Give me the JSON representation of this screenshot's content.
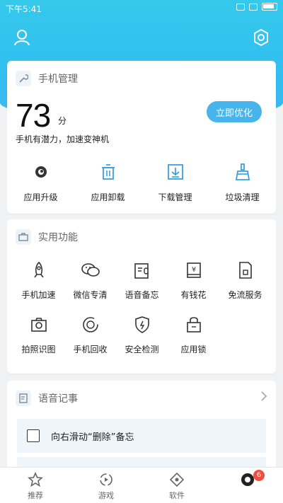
{
  "status_bar": {
    "time": "下午5:41"
  },
  "header": {
    "user_icon": "user-icon",
    "settings_icon": "settings-icon"
  },
  "phone_manager": {
    "title": "手机管理",
    "score": "73",
    "score_unit": "分",
    "description": "手机有潜力，加速变神机",
    "optimize_button": "立即优化",
    "tools": [
      {
        "label": "应用升级",
        "icon": "eye-icon"
      },
      {
        "label": "应用卸载",
        "icon": "trash-icon"
      },
      {
        "label": "下载管理",
        "icon": "download-icon"
      },
      {
        "label": "垃圾清理",
        "icon": "broom-icon"
      }
    ]
  },
  "utilities": {
    "title": "实用功能",
    "items": [
      {
        "label": "手机加速",
        "icon": "rocket-icon"
      },
      {
        "label": "微信专清",
        "icon": "wechat-icon"
      },
      {
        "label": "语音备忘",
        "icon": "voice-memo-icon"
      },
      {
        "label": "有钱花",
        "icon": "money-icon"
      },
      {
        "label": "免流服务",
        "icon": "sim-icon"
      },
      {
        "label": "拍照识图",
        "icon": "camera-icon"
      },
      {
        "label": "手机回收",
        "icon": "recycle-icon"
      },
      {
        "label": "安全检测",
        "icon": "shield-icon"
      },
      {
        "label": "应用锁",
        "icon": "lock-icon"
      }
    ]
  },
  "voice_notes": {
    "title": "语音记事",
    "memo": "向右滑动“删除”备忘"
  },
  "bottom_nav": [
    {
      "label": "推荐",
      "icon": "star-icon"
    },
    {
      "label": "游戏",
      "icon": "game-icon"
    },
    {
      "label": "软件",
      "icon": "software-icon"
    },
    {
      "label": "",
      "icon": "manage-icon",
      "badge": "6"
    }
  ],
  "colors": {
    "header": "#35c9ec",
    "accent": "#47b4ec",
    "badge": "#f24c3d"
  }
}
